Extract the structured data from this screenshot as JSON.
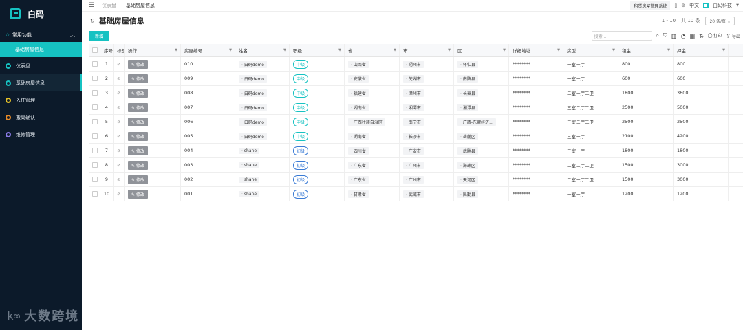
{
  "app": {
    "name": "白码"
  },
  "sidebar": {
    "group": {
      "label": "常用功能"
    },
    "sub_active": "基础房屋信息",
    "items": [
      {
        "label": "仪表盘",
        "color": "#16c2c2"
      },
      {
        "label": "基础房屋信息",
        "color": "#16c2c2"
      },
      {
        "label": "入住管理",
        "color": "#e6c229"
      },
      {
        "label": "搬离确认",
        "color": "#e68a29"
      },
      {
        "label": "维修管理",
        "color": "#8a7be6"
      }
    ],
    "watermark": "大数跨境"
  },
  "topbar": {
    "breadcrumb_1": "仪表盘",
    "breadcrumb_2": "基础房屋信息",
    "system_name": "租赁房屋管理系统",
    "lang": "中文",
    "company": "白码科技"
  },
  "page": {
    "title": "基础房屋信息",
    "pager_range": "1 - 10",
    "pager_total": "共 10 条",
    "page_size": "20 条/页",
    "add_label": "新增",
    "search_placeholder": "搜索...",
    "print_label": "打印",
    "export_label": "导出"
  },
  "table": {
    "columns": [
      "序号",
      "标签",
      "操作",
      "房屋编号",
      "姓名",
      "职级",
      "省",
      "市",
      "区",
      "详细地址",
      "房型",
      "租金",
      "押金"
    ],
    "edit_label": "修改",
    "rows": [
      {
        "no": "1",
        "code": "010",
        "name": "白码demo",
        "level": "中级",
        "prov": "山西省",
        "city": "朔州市",
        "dist": "怀仁县",
        "addr": "********",
        "type": "一室一厅",
        "rent": "800",
        "deposit": "800"
      },
      {
        "no": "2",
        "code": "009",
        "name": "白码demo",
        "level": "中级",
        "prov": "安徽省",
        "city": "芜湖市",
        "dist": "南陵县",
        "addr": "********",
        "type": "一室一厅",
        "rent": "600",
        "deposit": "600"
      },
      {
        "no": "3",
        "code": "008",
        "name": "白码demo",
        "level": "中级",
        "prov": "福建省",
        "city": "漳州市",
        "dist": "长泰县",
        "addr": "********",
        "type": "二室一厅二卫",
        "rent": "1800",
        "deposit": "3600"
      },
      {
        "no": "4",
        "code": "007",
        "name": "白码demo",
        "level": "中级",
        "prov": "湖南省",
        "city": "湘潭市",
        "dist": "湘潭县",
        "addr": "********",
        "type": "三室二厅二卫",
        "rent": "2500",
        "deposit": "5000"
      },
      {
        "no": "5",
        "code": "006",
        "name": "白码demo",
        "level": "中级",
        "prov": "广西壮族自治区",
        "city": "南宁市",
        "dist": "广西-东盟经济…",
        "addr": "********",
        "type": "三室二厅二卫",
        "rent": "2500",
        "deposit": "2500"
      },
      {
        "no": "6",
        "code": "005",
        "name": "白码demo",
        "level": "中级",
        "prov": "湖南省",
        "city": "长沙市",
        "dist": "岳麓区",
        "addr": "********",
        "type": "三室一厅",
        "rent": "2100",
        "deposit": "4200"
      },
      {
        "no": "7",
        "code": "004",
        "name": "shane",
        "level": "初级",
        "prov": "四川省",
        "city": "广安市",
        "dist": "武胜县",
        "addr": "********",
        "type": "三室一厅",
        "rent": "1800",
        "deposit": "1800"
      },
      {
        "no": "8",
        "code": "003",
        "name": "shane",
        "level": "初级",
        "prov": "广东省",
        "city": "广州市",
        "dist": "海珠区",
        "addr": "********",
        "type": "二室二厅二卫",
        "rent": "1500",
        "deposit": "3000"
      },
      {
        "no": "9",
        "code": "002",
        "name": "shane",
        "level": "初级",
        "prov": "广东省",
        "city": "广州市",
        "dist": "天河区",
        "addr": "********",
        "type": "二室一厅二卫",
        "rent": "1500",
        "deposit": "3000"
      },
      {
        "no": "10",
        "code": "001",
        "name": "shane",
        "level": "初级",
        "prov": "甘肃省",
        "city": "武威市",
        "dist": "民勤县",
        "addr": "********",
        "type": "一室一厅",
        "rent": "1200",
        "deposit": "1200"
      }
    ]
  },
  "colors": {
    "accent": "#16c2c2",
    "sidebar_bg": "#0c1a2a",
    "level_primary": "#3a7bd5"
  }
}
